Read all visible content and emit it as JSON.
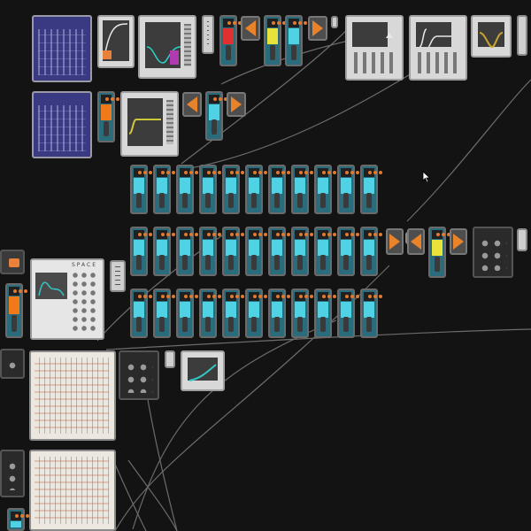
{
  "workspace": {
    "space_label": "SPACE",
    "colors": {
      "background": "#131313",
      "pedal_cyan": "#4fd2e4",
      "pedal_yellow": "#e8e23a",
      "pedal_orange": "#f07a1a",
      "pedal_red": "#e03030",
      "arrow_orange": "#e8832a",
      "synth_purple": "#3a3a82",
      "curve_purple": "#b03ab0",
      "curve_gold": "#c8a42a",
      "curve_yellow": "#cfc73a",
      "curve_teal": "#33c6c6",
      "cable": "#8a8a8a"
    },
    "pedal_matrix": {
      "rows": 3,
      "columns": 11,
      "color": "pedal_cyan"
    },
    "icons": [
      "mouse-cursor-icon",
      "chevron-right-icon",
      "chevron-left-icon"
    ]
  }
}
